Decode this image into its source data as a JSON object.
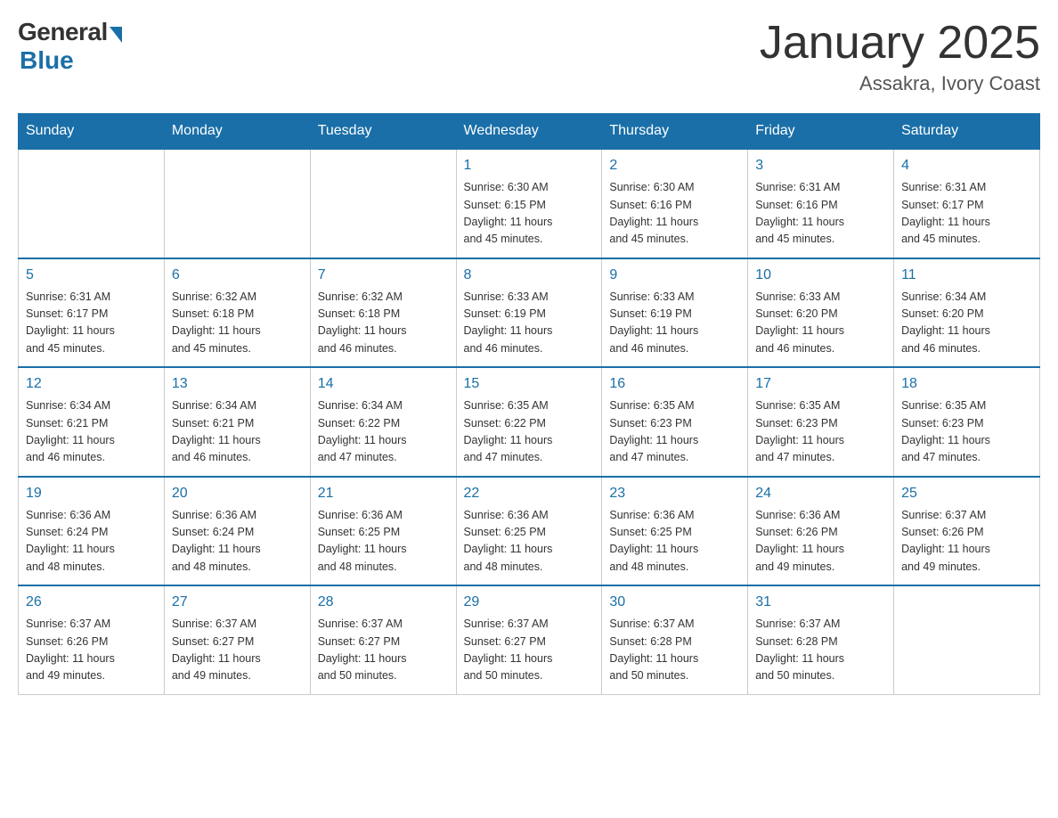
{
  "logo": {
    "general": "General",
    "blue": "Blue"
  },
  "title": "January 2025",
  "location": "Assakra, Ivory Coast",
  "days_of_week": [
    "Sunday",
    "Monday",
    "Tuesday",
    "Wednesday",
    "Thursday",
    "Friday",
    "Saturday"
  ],
  "weeks": [
    [
      {
        "day": "",
        "info": ""
      },
      {
        "day": "",
        "info": ""
      },
      {
        "day": "",
        "info": ""
      },
      {
        "day": "1",
        "info": "Sunrise: 6:30 AM\nSunset: 6:15 PM\nDaylight: 11 hours\nand 45 minutes."
      },
      {
        "day": "2",
        "info": "Sunrise: 6:30 AM\nSunset: 6:16 PM\nDaylight: 11 hours\nand 45 minutes."
      },
      {
        "day": "3",
        "info": "Sunrise: 6:31 AM\nSunset: 6:16 PM\nDaylight: 11 hours\nand 45 minutes."
      },
      {
        "day": "4",
        "info": "Sunrise: 6:31 AM\nSunset: 6:17 PM\nDaylight: 11 hours\nand 45 minutes."
      }
    ],
    [
      {
        "day": "5",
        "info": "Sunrise: 6:31 AM\nSunset: 6:17 PM\nDaylight: 11 hours\nand 45 minutes."
      },
      {
        "day": "6",
        "info": "Sunrise: 6:32 AM\nSunset: 6:18 PM\nDaylight: 11 hours\nand 45 minutes."
      },
      {
        "day": "7",
        "info": "Sunrise: 6:32 AM\nSunset: 6:18 PM\nDaylight: 11 hours\nand 46 minutes."
      },
      {
        "day": "8",
        "info": "Sunrise: 6:33 AM\nSunset: 6:19 PM\nDaylight: 11 hours\nand 46 minutes."
      },
      {
        "day": "9",
        "info": "Sunrise: 6:33 AM\nSunset: 6:19 PM\nDaylight: 11 hours\nand 46 minutes."
      },
      {
        "day": "10",
        "info": "Sunrise: 6:33 AM\nSunset: 6:20 PM\nDaylight: 11 hours\nand 46 minutes."
      },
      {
        "day": "11",
        "info": "Sunrise: 6:34 AM\nSunset: 6:20 PM\nDaylight: 11 hours\nand 46 minutes."
      }
    ],
    [
      {
        "day": "12",
        "info": "Sunrise: 6:34 AM\nSunset: 6:21 PM\nDaylight: 11 hours\nand 46 minutes."
      },
      {
        "day": "13",
        "info": "Sunrise: 6:34 AM\nSunset: 6:21 PM\nDaylight: 11 hours\nand 46 minutes."
      },
      {
        "day": "14",
        "info": "Sunrise: 6:34 AM\nSunset: 6:22 PM\nDaylight: 11 hours\nand 47 minutes."
      },
      {
        "day": "15",
        "info": "Sunrise: 6:35 AM\nSunset: 6:22 PM\nDaylight: 11 hours\nand 47 minutes."
      },
      {
        "day": "16",
        "info": "Sunrise: 6:35 AM\nSunset: 6:23 PM\nDaylight: 11 hours\nand 47 minutes."
      },
      {
        "day": "17",
        "info": "Sunrise: 6:35 AM\nSunset: 6:23 PM\nDaylight: 11 hours\nand 47 minutes."
      },
      {
        "day": "18",
        "info": "Sunrise: 6:35 AM\nSunset: 6:23 PM\nDaylight: 11 hours\nand 47 minutes."
      }
    ],
    [
      {
        "day": "19",
        "info": "Sunrise: 6:36 AM\nSunset: 6:24 PM\nDaylight: 11 hours\nand 48 minutes."
      },
      {
        "day": "20",
        "info": "Sunrise: 6:36 AM\nSunset: 6:24 PM\nDaylight: 11 hours\nand 48 minutes."
      },
      {
        "day": "21",
        "info": "Sunrise: 6:36 AM\nSunset: 6:25 PM\nDaylight: 11 hours\nand 48 minutes."
      },
      {
        "day": "22",
        "info": "Sunrise: 6:36 AM\nSunset: 6:25 PM\nDaylight: 11 hours\nand 48 minutes."
      },
      {
        "day": "23",
        "info": "Sunrise: 6:36 AM\nSunset: 6:25 PM\nDaylight: 11 hours\nand 48 minutes."
      },
      {
        "day": "24",
        "info": "Sunrise: 6:36 AM\nSunset: 6:26 PM\nDaylight: 11 hours\nand 49 minutes."
      },
      {
        "day": "25",
        "info": "Sunrise: 6:37 AM\nSunset: 6:26 PM\nDaylight: 11 hours\nand 49 minutes."
      }
    ],
    [
      {
        "day": "26",
        "info": "Sunrise: 6:37 AM\nSunset: 6:26 PM\nDaylight: 11 hours\nand 49 minutes."
      },
      {
        "day": "27",
        "info": "Sunrise: 6:37 AM\nSunset: 6:27 PM\nDaylight: 11 hours\nand 49 minutes."
      },
      {
        "day": "28",
        "info": "Sunrise: 6:37 AM\nSunset: 6:27 PM\nDaylight: 11 hours\nand 50 minutes."
      },
      {
        "day": "29",
        "info": "Sunrise: 6:37 AM\nSunset: 6:27 PM\nDaylight: 11 hours\nand 50 minutes."
      },
      {
        "day": "30",
        "info": "Sunrise: 6:37 AM\nSunset: 6:28 PM\nDaylight: 11 hours\nand 50 minutes."
      },
      {
        "day": "31",
        "info": "Sunrise: 6:37 AM\nSunset: 6:28 PM\nDaylight: 11 hours\nand 50 minutes."
      },
      {
        "day": "",
        "info": ""
      }
    ]
  ]
}
